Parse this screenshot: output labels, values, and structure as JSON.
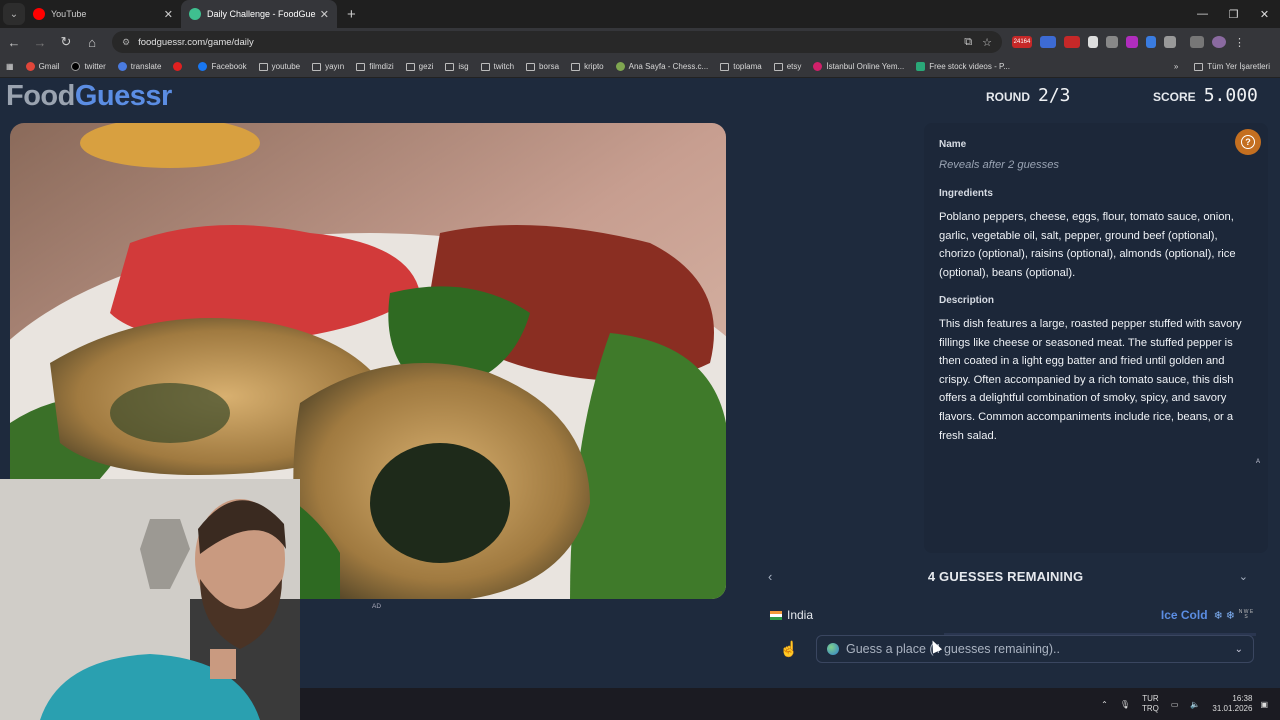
{
  "browser": {
    "tabs": [
      {
        "title": "YouTube",
        "color": "#ff0000"
      },
      {
        "title": "Daily Challenge - FoodGuessr |",
        "color": "#3fbf8f"
      }
    ],
    "url": "foodguessr.com/game/daily",
    "bookmarks": [
      "Gmail",
      "twitter",
      "translate",
      "",
      "Facebook",
      "youtube",
      "yayın",
      "filmdizi",
      "gezi",
      "isg",
      "twitch",
      "borsa",
      "kripto",
      "Ana Sayfa - Chess.c...",
      "toplama",
      "etsy",
      "İstanbul Online Yem...",
      "Free stock videos - P..."
    ],
    "bookmarks_more": "»",
    "all_bookmarks": "Tüm Yer İşaretleri",
    "badge": "24164"
  },
  "game": {
    "logo_a": "Food",
    "logo_b": "Guessr",
    "round_label": "ROUND",
    "round_value": "2/3",
    "score_label": "SCORE",
    "score_value": "5.000",
    "ad_label": "AD"
  },
  "clues": {
    "name_heading": "Name",
    "name_reveal": "Reveals after 2 guesses",
    "ingredients_heading": "Ingredients",
    "ingredients": "Poblano peppers, cheese, eggs, flour, tomato sauce, onion, garlic, vegetable oil, salt, pepper, ground beef (optional), chorizo (optional), raisins (optional), almonds (optional), rice (optional), beans (optional).",
    "description_heading": "Description",
    "description": "This dish features a large, roasted pepper stuffed with savory fillings like cheese or seasoned meat. The stuffed pepper is then coated in a light egg batter and fried until golden and crispy. Often accompanied by a rich tomato sauce, this dish offers a delightful combination of smoky, spicy, and savory flavors. Common accompaniments include rice, beans, or a fresh salad.",
    "small_a": "A"
  },
  "guesses": {
    "remaining_title": "4 GUESSES REMAINING",
    "previous": [
      {
        "country": "India",
        "temperature": "Ice Cold",
        "compass": "N W E S"
      }
    ],
    "input_placeholder": "Guess a place (4 guesses remaining).."
  },
  "taskbar": {
    "lang_top": "TUR",
    "lang_bottom": "TRQ",
    "time": "16:38",
    "date": "31.01.2026"
  }
}
